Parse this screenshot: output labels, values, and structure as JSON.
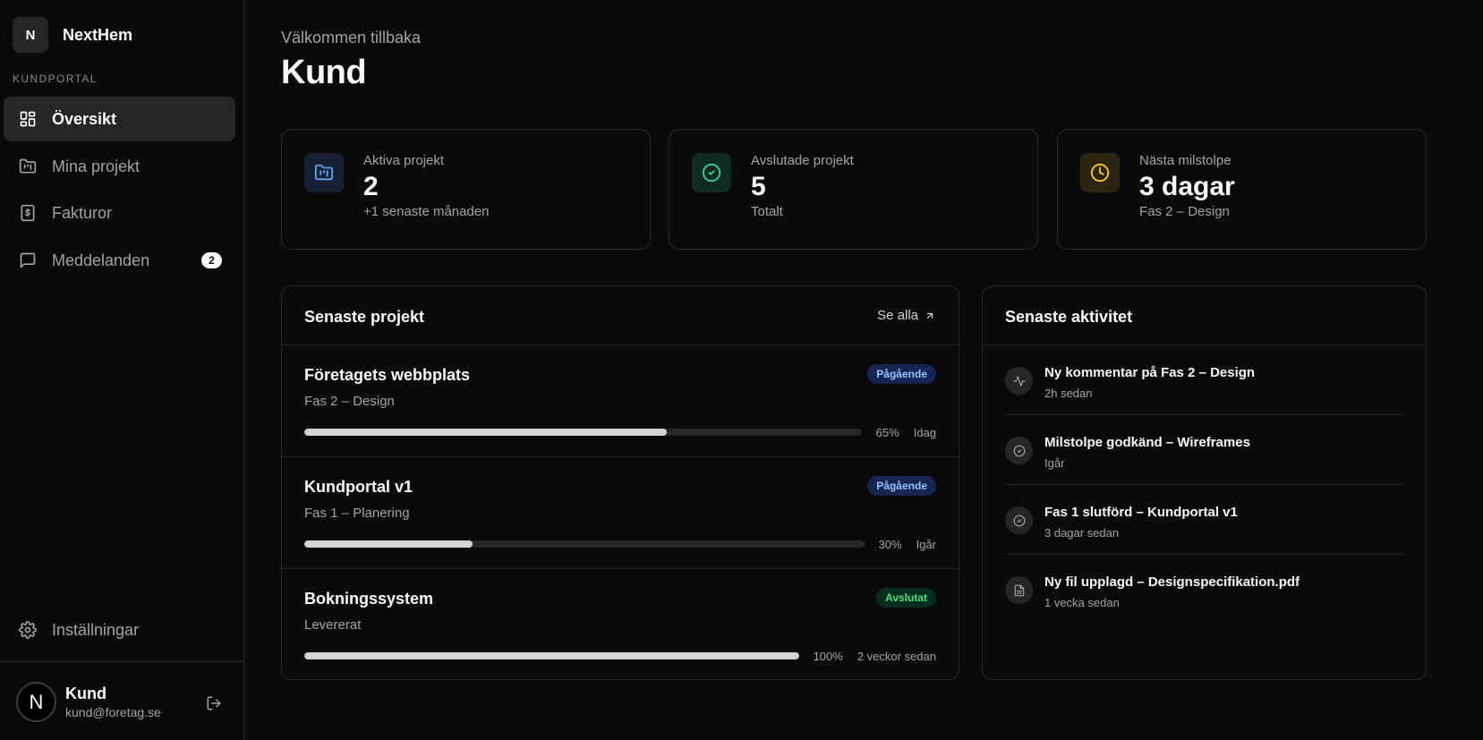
{
  "brand": {
    "logo_letter": "N",
    "name": "NextHem"
  },
  "sidebar": {
    "section_label": "KUNDPORTAL",
    "items": [
      {
        "label": "Översikt",
        "icon": "dashboard-icon",
        "active": true
      },
      {
        "label": "Mina projekt",
        "icon": "folder-kanban-icon",
        "active": false
      },
      {
        "label": "Fakturor",
        "icon": "receipt-icon",
        "active": false
      },
      {
        "label": "Meddelanden",
        "icon": "message-icon",
        "active": false,
        "badge": "2"
      }
    ],
    "settings_label": "Inställningar"
  },
  "user": {
    "avatar_letter": "N",
    "name": "Kund",
    "email": "kund@foretag.se"
  },
  "header": {
    "welcome": "Välkommen tillbaka",
    "title": "Kund"
  },
  "stats": [
    {
      "label": "Aktiva projekt",
      "value": "2",
      "sub": "+1 senaste månaden",
      "icon": "folder-icon",
      "color": "#60a5fa"
    },
    {
      "label": "Avslutade projekt",
      "value": "5",
      "sub": "Totalt",
      "icon": "check-circle-icon",
      "color": "#34d399"
    },
    {
      "label": "Nästa milstolpe",
      "value": "3 dagar",
      "sub": "Fas 2 – Design",
      "icon": "clock-icon",
      "color": "#facc15"
    }
  ],
  "projects_panel": {
    "title": "Senaste projekt",
    "see_all": "Se alla",
    "items": [
      {
        "name": "Företagets webbplats",
        "phase": "Fas 2 – Design",
        "status": "Pågående",
        "status_kind": "ongoing",
        "progress": 65,
        "progress_label": "65%",
        "when": "Idag"
      },
      {
        "name": "Kundportal v1",
        "phase": "Fas 1 – Planering",
        "status": "Pågående",
        "status_kind": "ongoing",
        "progress": 30,
        "progress_label": "30%",
        "when": "Igår"
      },
      {
        "name": "Bokningssystem",
        "phase": "Levererat",
        "status": "Avslutat",
        "status_kind": "done",
        "progress": 100,
        "progress_label": "100%",
        "when": "2 veckor sedan"
      }
    ]
  },
  "activity_panel": {
    "title": "Senaste aktivitet",
    "items": [
      {
        "title": "Ny kommentar på Fas 2 – Design",
        "time": "2h sedan",
        "icon": "activity-icon"
      },
      {
        "title": "Milstolpe godkänd – Wireframes",
        "time": "Igår",
        "icon": "check-circle-icon"
      },
      {
        "title": "Fas 1 slutförd – Kundportal v1",
        "time": "3 dagar sedan",
        "icon": "check-circle-icon"
      },
      {
        "title": "Ny fil upplagd – Designspecifikation.pdf",
        "time": "1 vecka sedan",
        "icon": "file-icon"
      }
    ]
  }
}
